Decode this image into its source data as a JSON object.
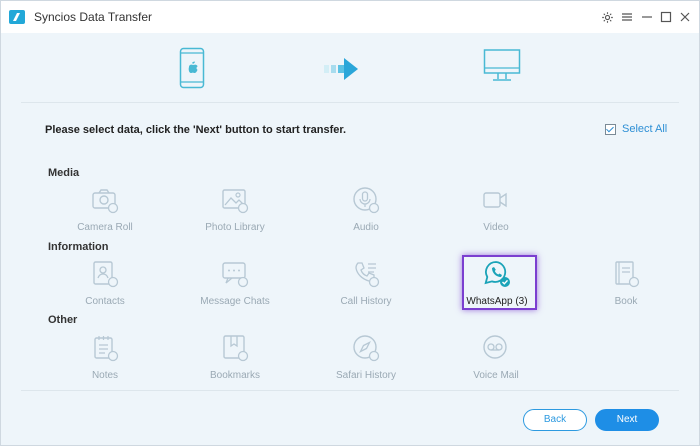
{
  "window": {
    "title": "Syncios Data Transfer"
  },
  "titlebar_icons": [
    "gear-icon",
    "menu-icon",
    "minimize-icon",
    "maximize-icon",
    "close-icon"
  ],
  "stage": {
    "source_icon": "apple-phone-icon",
    "arrow_icon": "arrow-right-icon",
    "target_icon": "computer-monitor-icon"
  },
  "prompt": "Please select data, click the 'Next' button to start transfer.",
  "select_all": {
    "label": "Select All",
    "checked": true
  },
  "sections": {
    "media": {
      "title": "Media",
      "items": [
        "Camera Roll",
        "Photo Library",
        "Audio",
        "Video"
      ]
    },
    "information": {
      "title": "Information",
      "items": [
        "Contacts",
        "Message Chats",
        "Call History",
        "WhatsApp (3)",
        "Book"
      ]
    },
    "other": {
      "title": "Other",
      "items": [
        "Notes",
        "Bookmarks",
        "Safari History",
        "Voice Mail"
      ]
    }
  },
  "buttons": {
    "back": "Back",
    "next": "Next"
  },
  "colors": {
    "accent": "#1e8ee6",
    "highlight": "#7b3fd0",
    "icon_muted": "#b7c8d4",
    "whatsapp_teal": "#1aa3b8"
  }
}
